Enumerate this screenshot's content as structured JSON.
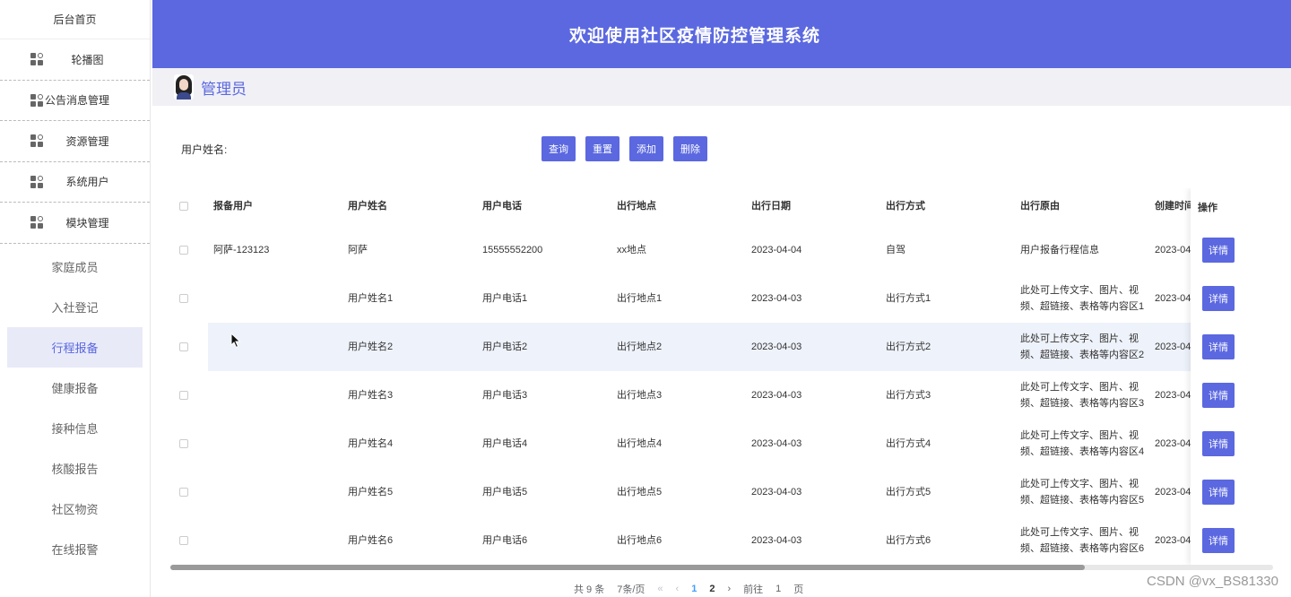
{
  "sidebar": {
    "home": "后台首页",
    "menus": [
      {
        "label": "轮播图",
        "icon": "grid-icon"
      },
      {
        "label": "公告消息管理",
        "icon": "grid-icon"
      },
      {
        "label": "资源管理",
        "icon": "grid-icon"
      },
      {
        "label": "系统用户",
        "icon": "grid-icon"
      },
      {
        "label": "模块管理",
        "icon": "grid-icon"
      }
    ],
    "submenus": [
      "家庭成员",
      "入社登记",
      "行程报备",
      "健康报备",
      "接种信息",
      "核酸报告",
      "社区物资",
      "在线报警"
    ],
    "active_submenu": "行程报备"
  },
  "header": {
    "title": "欢迎使用社区疫情防控管理系统"
  },
  "user": {
    "name": "管理员"
  },
  "search": {
    "label": "用户姓名:",
    "value": ""
  },
  "buttons": {
    "query": "查询",
    "reset": "重置",
    "add": "添加",
    "delete": "删除"
  },
  "table": {
    "columns": [
      "报备用户",
      "用户姓名",
      "用户电话",
      "出行地点",
      "出行日期",
      "出行方式",
      "出行原由",
      "创建时间",
      "操作"
    ],
    "rows": [
      {
        "user": "阿萨-123123",
        "name": "阿萨",
        "phone": "15555552200",
        "place": "xx地点",
        "date": "2023-04-04",
        "mode": "自驾",
        "reason1": "用户报备行程信息",
        "reason2": "",
        "created": "2023-04-"
      },
      {
        "user": "",
        "name": "用户姓名1",
        "phone": "用户电话1",
        "place": "出行地点1",
        "date": "2023-04-03",
        "mode": "出行方式1",
        "reason1": "此处可上传文字、图片、视",
        "reason2": "频、超链接、表格等内容区1",
        "created": "2023-04-"
      },
      {
        "user": "",
        "name": "用户姓名2",
        "phone": "用户电话2",
        "place": "出行地点2",
        "date": "2023-04-03",
        "mode": "出行方式2",
        "reason1": "此处可上传文字、图片、视",
        "reason2": "频、超链接、表格等内容区2",
        "created": "2023-04-"
      },
      {
        "user": "",
        "name": "用户姓名3",
        "phone": "用户电话3",
        "place": "出行地点3",
        "date": "2023-04-03",
        "mode": "出行方式3",
        "reason1": "此处可上传文字、图片、视",
        "reason2": "频、超链接、表格等内容区3",
        "created": "2023-04-"
      },
      {
        "user": "",
        "name": "用户姓名4",
        "phone": "用户电话4",
        "place": "出行地点4",
        "date": "2023-04-03",
        "mode": "出行方式4",
        "reason1": "此处可上传文字、图片、视",
        "reason2": "频、超链接、表格等内容区4",
        "created": "2023-04-"
      },
      {
        "user": "",
        "name": "用户姓名5",
        "phone": "用户电话5",
        "place": "出行地点5",
        "date": "2023-04-03",
        "mode": "出行方式5",
        "reason1": "此处可上传文字、图片、视",
        "reason2": "频、超链接、表格等内容区5",
        "created": "2023-04-"
      },
      {
        "user": "",
        "name": "用户姓名6",
        "phone": "用户电话6",
        "place": "出行地点6",
        "date": "2023-04-03",
        "mode": "出行方式6",
        "reason1": "此处可上传文字、图片、视",
        "reason2": "频、超链接、表格等内容区6",
        "created": "2023-04-"
      }
    ],
    "detail_label": "详情",
    "highlighted_row": 2
  },
  "pagination": {
    "total": "共 9 条",
    "page_size": "7条/页",
    "prev_more": "«",
    "prev": "‹",
    "pages": [
      "1",
      "2"
    ],
    "current": "1",
    "next": "›",
    "goto_label": "前往",
    "goto_value": "1",
    "goto_suffix": "页"
  },
  "watermark": "CSDN @vx_BS81330",
  "colors": {
    "primary": "#5b68e0",
    "highlight": "#eef2fa",
    "page_active": "#409eff"
  }
}
